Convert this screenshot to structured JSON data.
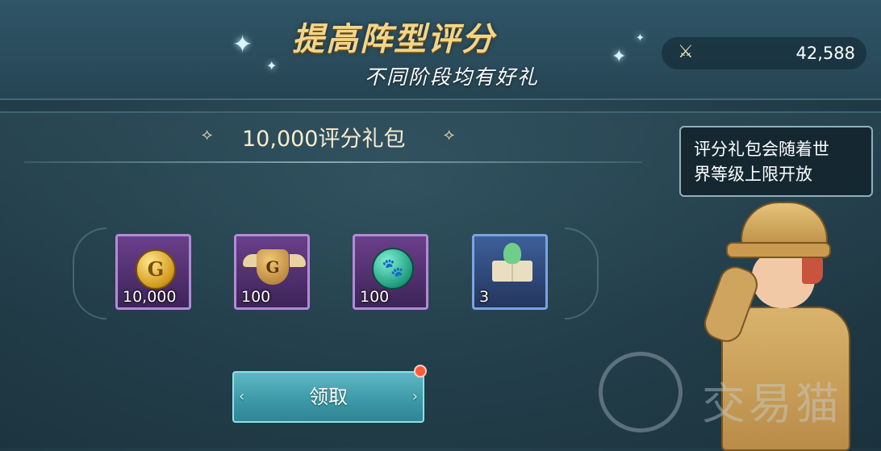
{
  "banner": {
    "title": "提高阵型评分",
    "subtitle": "不同阶段均有好礼",
    "power_value": "42,588"
  },
  "package": {
    "title": "10,000评分礼包",
    "deco_left": "⟡",
    "deco_right": "⟡"
  },
  "rewards": [
    {
      "icon": "gold-coin-icon",
      "count": "10,000",
      "rarity": "purple"
    },
    {
      "icon": "guild-badge-icon",
      "count": "100",
      "rarity": "purple"
    },
    {
      "icon": "paw-token-icon",
      "count": "100",
      "rarity": "purple"
    },
    {
      "icon": "spirit-book-icon",
      "count": "3",
      "rarity": "blue"
    }
  ],
  "claim": {
    "label": "领取",
    "has_notification": true
  },
  "tooltip": {
    "line1": "评分礼包会随着世",
    "line2": "界等级上限开放"
  },
  "watermark": {
    "text": "交易猫"
  },
  "colors": {
    "accent_gold": "#f3d58a",
    "button": "#3d9aa8",
    "purple_rarity": "#b48ad8",
    "blue_rarity": "#7aa4e0",
    "notify": "#ff5a3a"
  }
}
